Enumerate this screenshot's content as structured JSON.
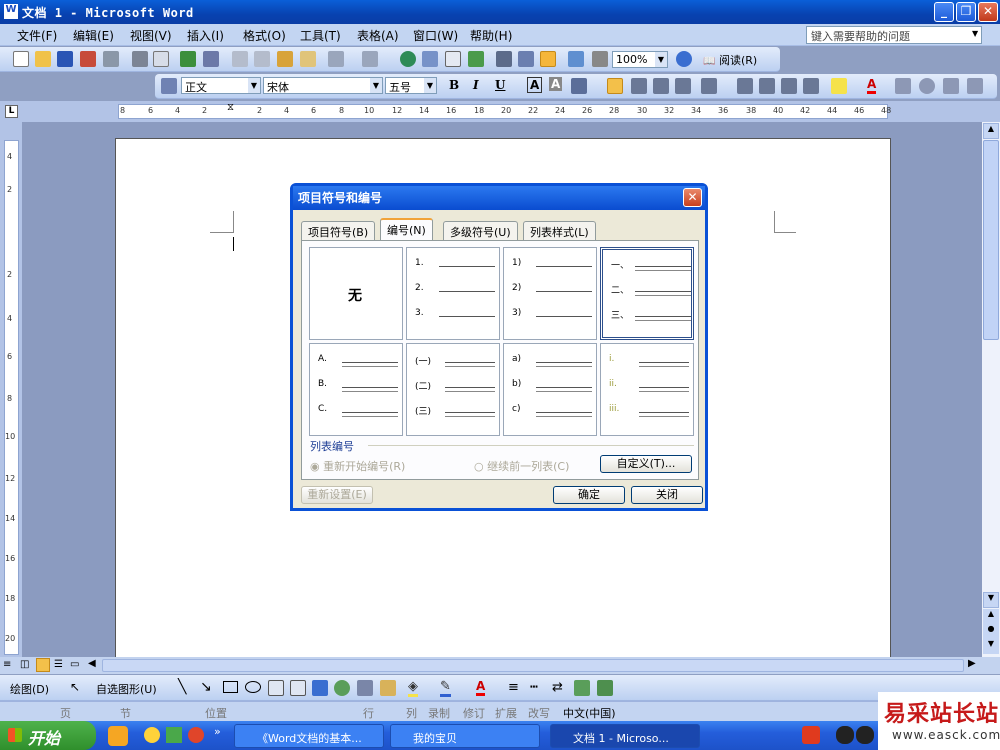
{
  "window": {
    "title": "文档 1 - Microsoft Word"
  },
  "menubar": {
    "items": [
      "文件(F)",
      "编辑(E)",
      "视图(V)",
      "插入(I)",
      "格式(O)",
      "工具(T)",
      "表格(A)",
      "窗口(W)",
      "帮助(H)"
    ],
    "help_placeholder": "键入需要帮助的问题"
  },
  "standard_toolbar": {
    "zoom": "100%",
    "read_label": "阅读(R)"
  },
  "format_toolbar": {
    "style": "正文",
    "font": "宋体",
    "size": "五号",
    "bold": "B",
    "italic": "I",
    "underline": "U",
    "charA": "A"
  },
  "ruler": {
    "h_left": [
      "8",
      "6",
      "4",
      "2"
    ],
    "h_right": [
      "2",
      "4",
      "6",
      "8",
      "10",
      "12",
      "14",
      "16",
      "18",
      "20",
      "22",
      "24",
      "26",
      "28",
      "30",
      "32",
      "34",
      "36",
      "38",
      "40",
      "42",
      "44",
      "46",
      "48"
    ],
    "v_marks": [
      "4",
      "2",
      "2",
      "4",
      "6",
      "8",
      "10",
      "12",
      "14",
      "16",
      "18",
      "20"
    ]
  },
  "dialog": {
    "title": "项目符号和编号",
    "tabs": [
      "项目符号(B)",
      "编号(N)",
      "多级符号(U)",
      "列表样式(L)"
    ],
    "active_tab": 1,
    "none_label": "无",
    "gallery": [
      [
        "1.",
        "2.",
        "3."
      ],
      [
        "1)",
        "2)",
        "3)"
      ],
      [
        "一、",
        "二、",
        "三、"
      ],
      [
        "A.",
        "B.",
        "C."
      ],
      [
        "(一)",
        "(二)",
        "(三)"
      ],
      [
        "a)",
        "b)",
        "c)"
      ],
      [
        "i.",
        "ii.",
        "iii."
      ]
    ],
    "list_numbering_label": "列表编号",
    "restart_label": "重新开始编号(R)",
    "continue_label": "继续前一列表(C)",
    "customize_label": "自定义(T)...",
    "reset_label": "重新设置(E)",
    "ok_label": "确定",
    "close_label": "关闭"
  },
  "drawbar": {
    "draw_label": "绘图(D)",
    "autoshape_label": "自选图形(U)"
  },
  "statusbar": {
    "items": [
      "页",
      "节",
      "位置",
      "行",
      "列",
      "录制",
      "修订",
      "扩展",
      "改写"
    ],
    "lang": "中文(中国)"
  },
  "taskbar": {
    "start_label": "开始",
    "tasks": [
      "《Word文档的基本...",
      "我的宝贝",
      "文档 1 - Microso..."
    ]
  },
  "watermark": {
    "line1": "易采站长站",
    "line2": "www.easck.com"
  }
}
